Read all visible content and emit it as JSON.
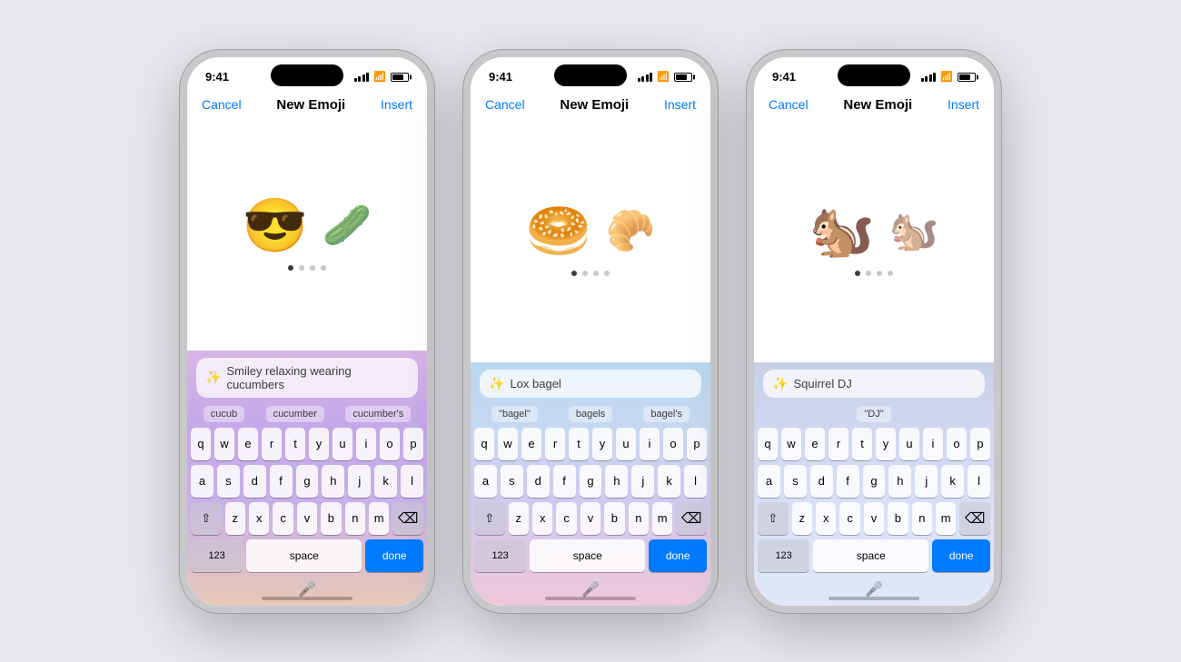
{
  "phones": [
    {
      "id": "phone-1",
      "statusTime": "9:41",
      "navCancel": "Cancel",
      "navTitle": "New Emoji",
      "navInsert": "Insert",
      "navInsertDisabled": false,
      "emojiLarge": "😎",
      "emojiMedium": "🥒",
      "searchText": "Smiley relaxing wearing cucumbers",
      "suggestions": [
        "cucub",
        "cucumber",
        "cucumber's"
      ],
      "gradientClass": "phone-1"
    },
    {
      "id": "phone-2",
      "statusTime": "9:41",
      "navCancel": "Cancel",
      "navTitle": "New Emoji",
      "navInsert": "Insert",
      "navInsertDisabled": false,
      "emojiLarge": "🥯",
      "emojiMedium": "🥐",
      "searchText": "Lox bagel",
      "suggestions": [
        "\"bagel\"",
        "bagels",
        "bagel's"
      ],
      "gradientClass": "phone-2"
    },
    {
      "id": "phone-3",
      "statusTime": "9:41",
      "navCancel": "Cancel",
      "navTitle": "New Emoji",
      "navInsert": "Insert",
      "navInsertDisabled": false,
      "emojiLarge": "🐿️",
      "emojiMedium": "🐿️",
      "searchText": "Squirrel DJ",
      "suggestions": [
        "\"DJ\""
      ],
      "gradientClass": "phone-3"
    }
  ],
  "keyboard": {
    "row1": [
      "q",
      "w",
      "e",
      "r",
      "t",
      "y",
      "u",
      "i",
      "o",
      "p"
    ],
    "row2": [
      "a",
      "s",
      "d",
      "f",
      "g",
      "h",
      "j",
      "k",
      "l"
    ],
    "row3": [
      "z",
      "x",
      "c",
      "v",
      "b",
      "n",
      "m"
    ],
    "numsLabel": "123",
    "spaceLabel": "space",
    "doneLabel": "done",
    "deleteSymbol": "⌫",
    "shiftSymbol": "⇧",
    "micSymbol": "🎤"
  }
}
